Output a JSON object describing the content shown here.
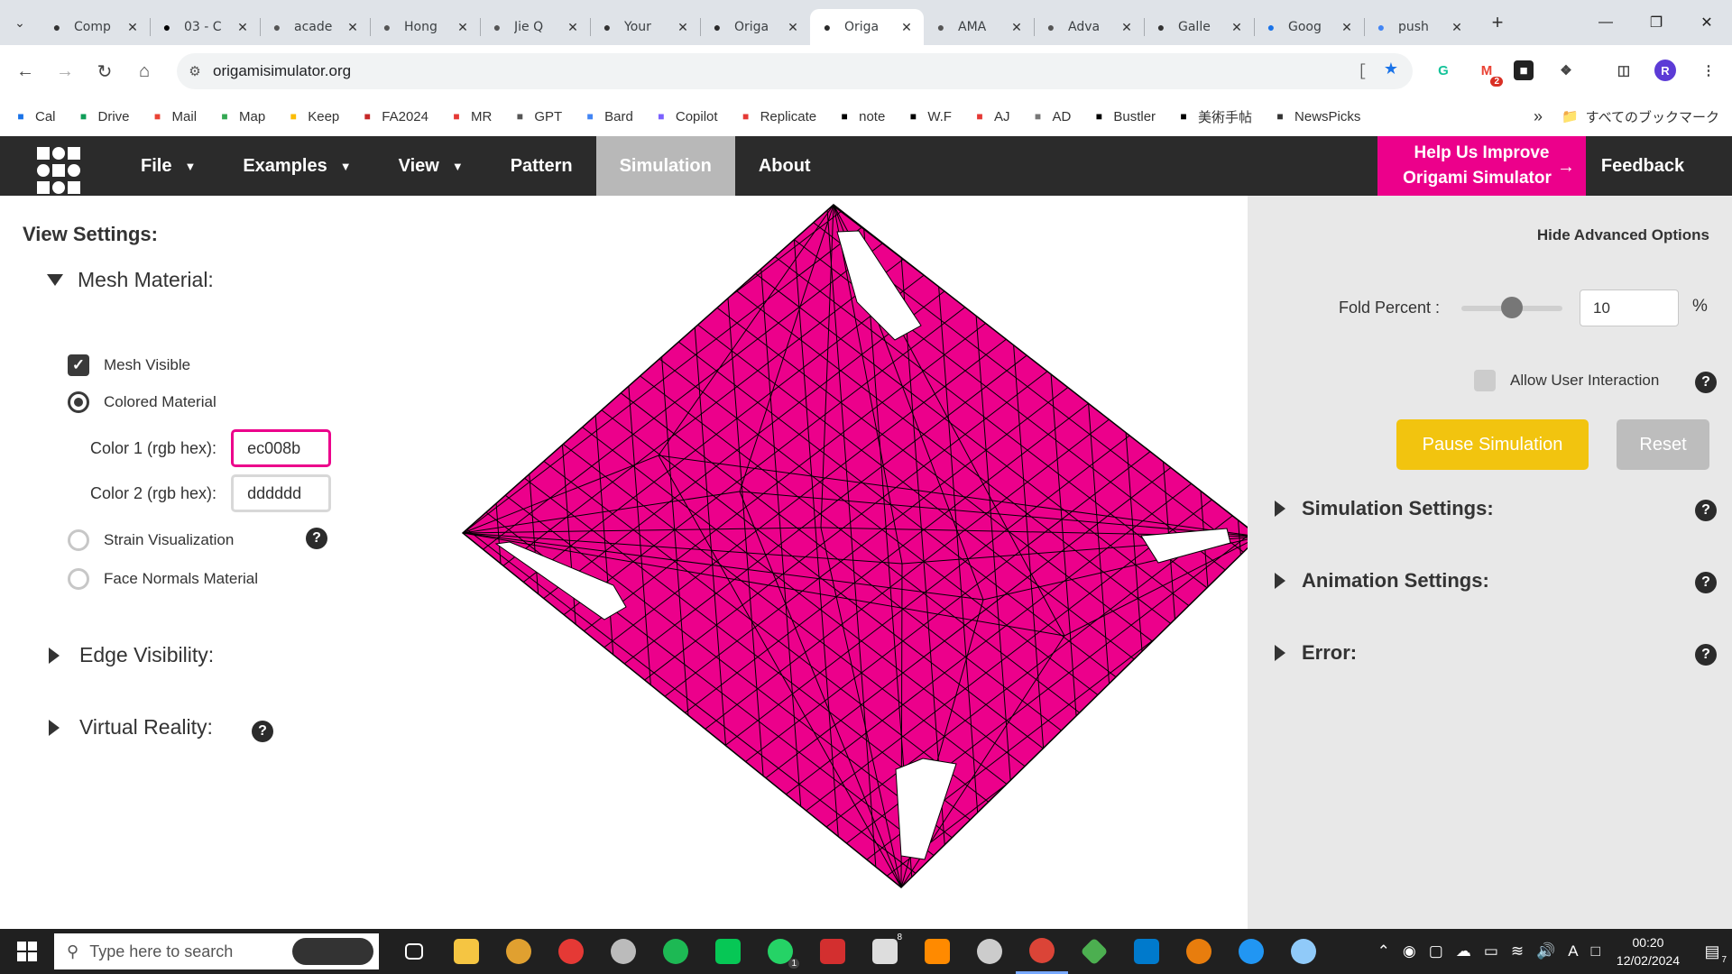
{
  "browser": {
    "tabs": [
      {
        "title": "Comp",
        "icon": "book-icon",
        "color": "#333333"
      },
      {
        "title": "03 - C",
        "icon": "site-icon",
        "color": "#000000"
      },
      {
        "title": "acade",
        "icon": "globe-icon",
        "color": "#555555"
      },
      {
        "title": "Hong",
        "icon": "globe-icon",
        "color": "#555555"
      },
      {
        "title": "Jie Q",
        "icon": "globe-icon",
        "color": "#555555"
      },
      {
        "title": "Your",
        "icon": "chatgpt-icon",
        "color": "#333333"
      },
      {
        "title": "Origa",
        "icon": "origami-icon",
        "color": "#2b2b2b"
      },
      {
        "title": "Origa",
        "icon": "origami-icon",
        "color": "#2b2b2b",
        "active": true
      },
      {
        "title": "AMA",
        "icon": "globe-icon",
        "color": "#555555"
      },
      {
        "title": "Adva",
        "icon": "globe-icon",
        "color": "#555555"
      },
      {
        "title": "Galle",
        "icon": "gallery-icon",
        "color": "#333333"
      },
      {
        "title": "Goog",
        "icon": "calendar-icon",
        "color": "#1a73e8"
      },
      {
        "title": "push",
        "icon": "google-icon",
        "color": "#4285f4"
      }
    ],
    "url": "origamisimulator.org",
    "bookmarks": [
      {
        "label": "Cal",
        "icon": "calendar-icon",
        "color": "#1a73e8"
      },
      {
        "label": "Drive",
        "icon": "drive-icon",
        "color": "#0f9d58"
      },
      {
        "label": "Mail",
        "icon": "gmail-icon",
        "color": "#ea4335"
      },
      {
        "label": "Map",
        "icon": "map-pin-icon",
        "color": "#34a853"
      },
      {
        "label": "Keep",
        "icon": "keep-icon",
        "color": "#fbbc04"
      },
      {
        "label": "FA2024",
        "icon": "fa-icon",
        "color": "#c62828"
      },
      {
        "label": "MR",
        "icon": "mr-icon",
        "color": "#e53935"
      },
      {
        "label": "GPT",
        "icon": "openai-icon",
        "color": "#555555"
      },
      {
        "label": "Bard",
        "icon": "bard-icon",
        "color": "#4285f4"
      },
      {
        "label": "Copilot",
        "icon": "copilot-icon",
        "color": "#7b61ff"
      },
      {
        "label": "Replicate",
        "icon": "replicate-icon",
        "color": "#e53935"
      },
      {
        "label": "note",
        "icon": "note-icon",
        "color": "#000000"
      },
      {
        "label": "W.F",
        "icon": "notion-icon",
        "color": "#000000"
      },
      {
        "label": "AJ",
        "icon": "aj-icon",
        "color": "#e53935"
      },
      {
        "label": "AD",
        "icon": "ad-icon",
        "color": "#777777"
      },
      {
        "label": "Bustler",
        "icon": "bustler-icon",
        "color": "#000000"
      },
      {
        "label": "美術手帖",
        "icon": "bt-icon",
        "color": "#000000"
      },
      {
        "label": "NewsPicks",
        "icon": "newspicks-icon",
        "color": "#333333"
      }
    ],
    "all_bookmarks": "すべてのブックマーク",
    "profile_letter": "R",
    "gmail_badge": "2"
  },
  "app": {
    "menu": [
      {
        "label": "File",
        "caret": true
      },
      {
        "label": "Examples",
        "caret": true
      },
      {
        "label": "View",
        "caret": true
      },
      {
        "label": "Pattern",
        "caret": false
      },
      {
        "label": "Simulation",
        "caret": false,
        "active": true
      },
      {
        "label": "About",
        "caret": false
      }
    ],
    "help_line1": "Help Us Improve",
    "help_line2": "Origami Simulator",
    "feedback": "Feedback",
    "accent": "#ec008b"
  },
  "left_panel": {
    "title": "View Settings:",
    "mesh_material": "Mesh Material:",
    "mesh_visible": "Mesh Visible",
    "colored_material": "Colored Material",
    "color1_label": "Color 1 (rgb hex):",
    "color1_value": "ec008b",
    "color2_label": "Color 2 (rgb hex):",
    "color2_value": "dddddd",
    "strain_visualization": "Strain Visualization",
    "face_normals": "Face Normals Material",
    "edge_visibility": "Edge Visibility:",
    "virtual_reality": "Virtual Reality:",
    "help": "?"
  },
  "right_panel": {
    "hide_advanced": "Hide Advanced Options",
    "fold_percent_label": "Fold Percent :",
    "fold_percent_value": "10",
    "fold_percent_fraction": 0.5,
    "percent_sign": "%",
    "allow_interaction": "Allow User Interaction",
    "pause": "Pause Simulation",
    "reset": "Reset",
    "simulation_settings": "Simulation Settings:",
    "animation_settings": "Animation Settings:",
    "error": "Error:",
    "help": "?"
  },
  "taskbar": {
    "search_placeholder": "Type here to search",
    "time": "00:20",
    "date": "12/02/2024",
    "notification_count": "7",
    "whatsapp_badge": "1",
    "app_badge": "8",
    "ime": "A"
  }
}
